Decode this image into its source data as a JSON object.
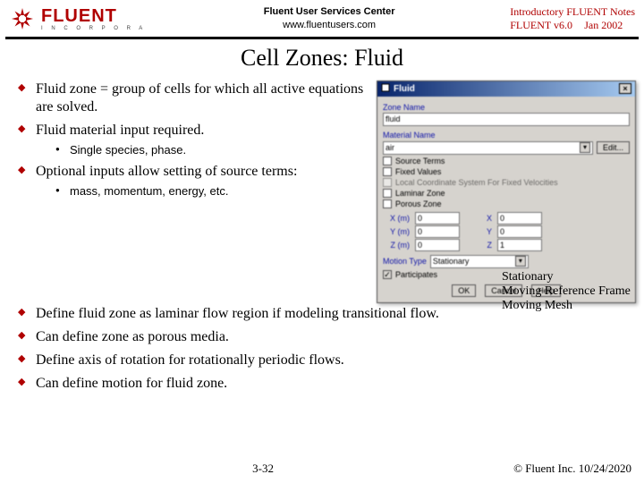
{
  "header": {
    "logo_brand": "FLUENT",
    "logo_sub": "INCORPORATED",
    "center_line1": "Fluent User Services Center",
    "center_line2": "www.fluentusers.com",
    "right_line1": "Introductory FLUENT Notes",
    "right_line2a": "FLUENT v6.0",
    "right_line2b": "Jan 2002"
  },
  "title": "Cell Zones: Fluid",
  "bullets": {
    "b1": "Fluid zone = group of cells for which all active equations are solved.",
    "b2": "Fluid material input required.",
    "b2s1": "Single species, phase.",
    "b3": "Optional inputs allow setting of source terms:",
    "b3s1": "mass, momentum, energy, etc.",
    "b4": "Define fluid zone as laminar flow region if modeling transitional flow.",
    "b5": "Can define zone as porous media.",
    "b6": "Define axis of rotation for rotationally periodic flows.",
    "b7": "Can define motion for fluid zone."
  },
  "dialog": {
    "title": "Fluid",
    "close_x": "×",
    "zone_name_label": "Zone Name",
    "zone_name_value": "fluid",
    "material_label": "Material Name",
    "material_value": "air",
    "edit_btn": "Edit...",
    "chk_source": "Source Terms",
    "chk_fixed": "Fixed Values",
    "chk_local": "Local Coordinate System For Fixed Velocities",
    "chk_laminar": "Laminar Zone",
    "chk_porous": "Porous Zone",
    "grid": {
      "x_lbl": "X (m)",
      "x_val": "0",
      "xr_lbl": "X",
      "xr_val": "0",
      "y_lbl": "Y (m)",
      "y_val": "0",
      "yr_lbl": "Y",
      "yr_val": "0",
      "z_lbl": "Z (m)",
      "z_val": "0",
      "zr_lbl": "Z",
      "zr_val": "1"
    },
    "motion_type_label": "Motion Type",
    "motion_type_value": "Stationary",
    "participates": "Participates",
    "popup": {
      "o1": "Stationary",
      "o2": "Moving Reference Frame",
      "o3": "Moving Mesh"
    },
    "ok": "OK",
    "cancel": "Cancel",
    "help": "Help"
  },
  "footer": {
    "page": "3-32",
    "copyright": "© Fluent Inc. 10/24/2020"
  }
}
